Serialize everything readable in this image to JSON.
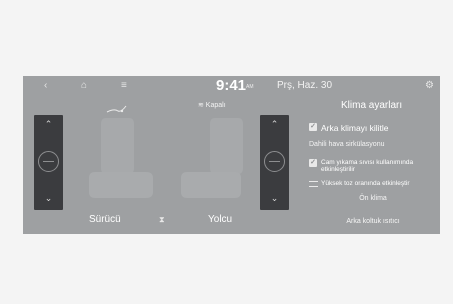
{
  "topbar": {
    "back_icon": "‹",
    "home_icon": "⌂",
    "menu_icon": "≡",
    "time": "9:41",
    "ampm": "AM",
    "date": "Prş, Haz. 30",
    "settings_icon": "⚙"
  },
  "climate": {
    "title": "Klima ayarları",
    "fan_icon": "fan",
    "status_text": "≋ Kapalı",
    "driver_label": "Sürücü",
    "passenger_label": "Yolcu",
    "up_arrow": "⌃",
    "down_arrow": "⌄"
  },
  "options": {
    "rear_climate_lock": "Arka klimayı kilitle",
    "internal_air_section": "Dahili hava sirkülasyonu",
    "washer_fluid_line1": "Cam yıkama sıvısı kullanımında",
    "washer_fluid_line2": "etkinleştirilir",
    "high_dust_line": "Yüksek toz oranında etkinleştir",
    "front_climate": "Ön klima",
    "rear_seat_heater": "Arka koltuk ısıtıcı"
  }
}
